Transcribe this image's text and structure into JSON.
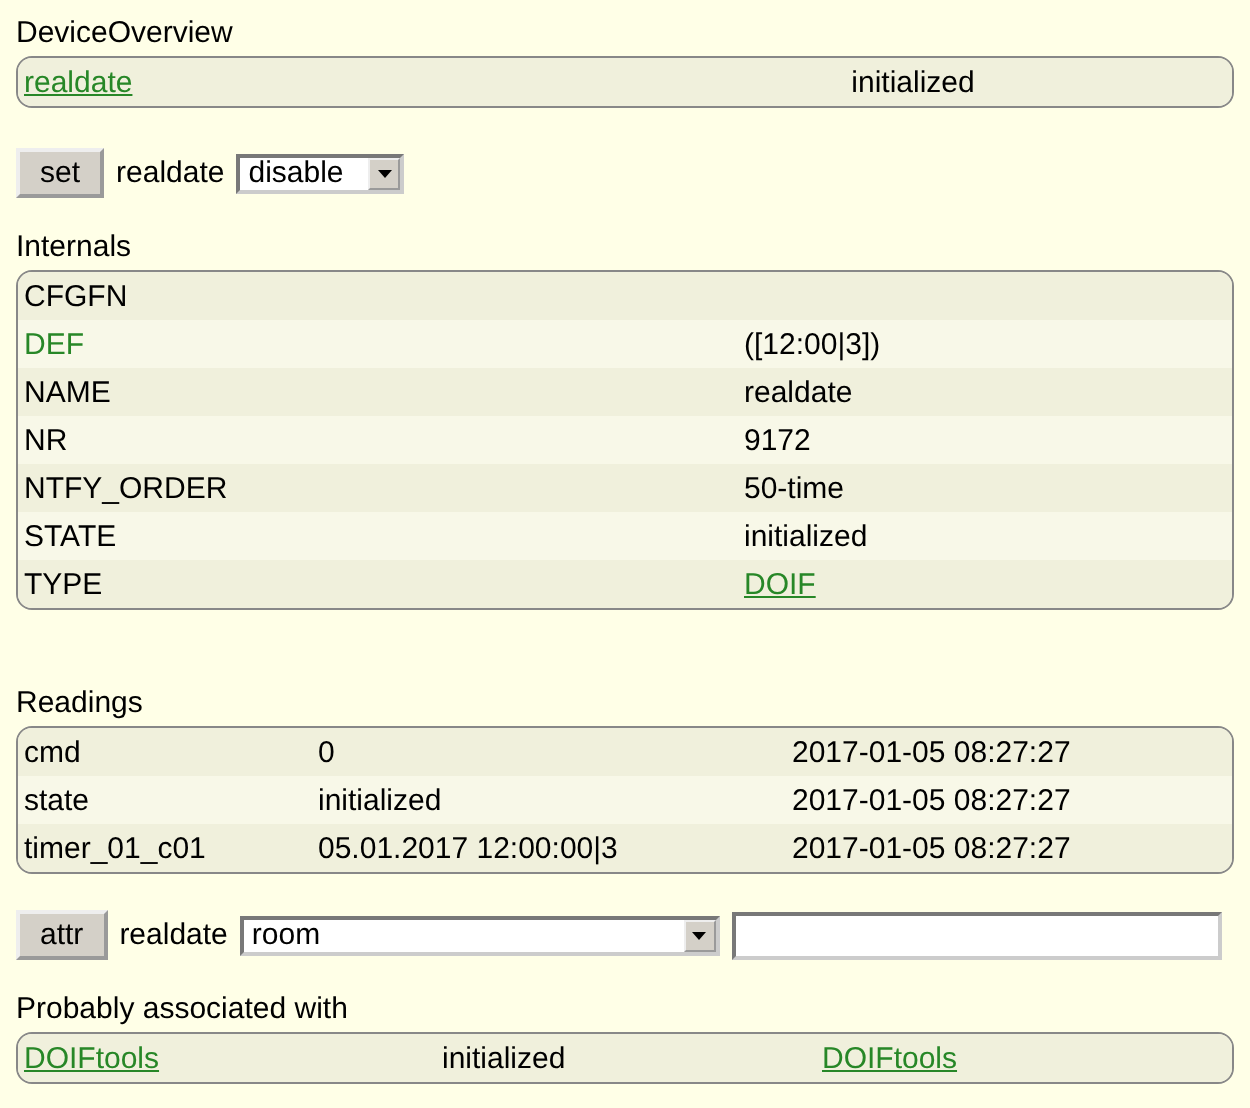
{
  "device_overview": {
    "title": "DeviceOverview",
    "rows": [
      {
        "name": "realdate",
        "state": "initialized"
      }
    ]
  },
  "set_command": {
    "button": "set",
    "device": "realdate",
    "value": "disable"
  },
  "internals": {
    "title": "Internals",
    "rows": [
      {
        "name": "CFGFN",
        "highlighted": false
      },
      {
        "name": "DEF",
        "value": "([12:00|3])",
        "highlighted": true,
        "link": false
      },
      {
        "name": "NAME",
        "value": "realdate",
        "highlighted": false,
        "link": false
      },
      {
        "name": "NR",
        "value": "9172",
        "highlighted": false,
        "link": false
      },
      {
        "name": "NTFY_ORDER",
        "value": "50-time",
        "highlighted": false,
        "link": false
      },
      {
        "name": "STATE",
        "value": "initialized",
        "highlighted": false,
        "link": false
      },
      {
        "name": "TYPE",
        "value": "DOIF",
        "highlighted": false,
        "link": true
      }
    ]
  },
  "readings": {
    "title": "Readings",
    "rows": [
      {
        "name": "cmd",
        "value": "0",
        "time": "2017-01-05 08:27:27"
      },
      {
        "name": "state",
        "value": "initialized",
        "time": "2017-01-05 08:27:27"
      },
      {
        "name": "timer_01_c01",
        "value": "05.01.2017 12:00:00|3",
        "time": "2017-01-05 08:27:27"
      }
    ]
  },
  "attr_command": {
    "button": "attr",
    "device": "realdate",
    "attribute": "room"
  },
  "associated": {
    "title": "Probably associated with",
    "rows": [
      {
        "name": "DOIFtools",
        "state": "initialized",
        "type": "DOIFtools"
      }
    ]
  }
}
